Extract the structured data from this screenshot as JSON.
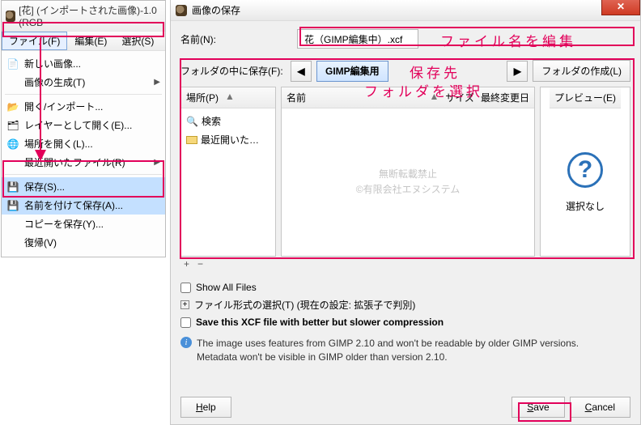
{
  "leftWindow": {
    "title": "[花] (インポートされた画像)-1.0 (RGB",
    "menus": {
      "file": "ファイル(F)",
      "edit": "編集(E)",
      "select": "選択(S)"
    },
    "dropdown": {
      "newImage": "新しい画像...",
      "create": "画像の生成(T)",
      "openImport": "開く/インポート...",
      "openAsLayer": "レイヤーとして開く(E)...",
      "openLocation": "場所を開く(L)...",
      "recent": "最近開いたファイル(R)",
      "save": "保存(S)...",
      "saveAs": "名前を付けて保存(A)...",
      "saveCopy": "コピーを保存(Y)...",
      "revert": "復帰(V)"
    }
  },
  "dialog": {
    "title": "画像の保存",
    "nameLabel": "名前(N):",
    "filename": "花（GIMP編集中）.xcf",
    "folderLabel": "フォルダの中に保存(F):",
    "pathCurrent": "GIMP編集用",
    "createFolder": "フォルダの作成(L)",
    "places": {
      "header": "場所(P)",
      "search": "検索",
      "recent": "最近開いた…"
    },
    "files": {
      "headerName": "名前",
      "headerSize": "サイズ",
      "headerModified": "最終変更日"
    },
    "preview": {
      "header": "プレビュー(E)",
      "noSelection": "選択なし"
    },
    "addRemove": {
      "plus": "+",
      "minus": "−"
    },
    "showAll": "Show All Files",
    "fileType": "ファイル形式の選択(T) (現在の設定: 拡張子で判別)",
    "betterCompress": "Save this XCF file with better but slower compression",
    "info1": "The image uses features from GIMP 2.10 and won't be readable by older GIMP versions.",
    "info2": "Metadata won't be visible in GIMP older than version 2.10.",
    "buttons": {
      "help": "Help",
      "save": "Save",
      "cancel": "Cancel"
    }
  },
  "watermark": {
    "line1": "無断転載禁止",
    "line2": "©有限会社エヌシステム"
  },
  "annotations": {
    "editFilename": "ファイル名を編集",
    "destFolder1": "保存先",
    "destFolder2": "フォルダを選択"
  }
}
